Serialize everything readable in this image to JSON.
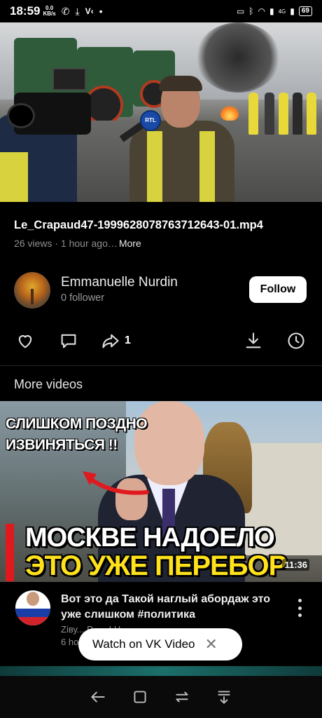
{
  "status_bar": {
    "time": "18:59",
    "speed_value": "0.0",
    "speed_unit": "KB/s",
    "battery": "69",
    "network": "4G"
  },
  "video": {
    "title": "Le_Crapaud47-1999628078763712643-01.mp4",
    "meta": "26 views · 1 hour ago…",
    "more_label": "More",
    "mic_logo": "RTL"
  },
  "channel": {
    "name": "Emmanuelle Nurdin",
    "followers": "0 follower",
    "follow_label": "Follow"
  },
  "actions": {
    "share_count": "1",
    "icons": [
      "heart-icon",
      "comment-icon",
      "share-icon",
      "download-icon",
      "clock-icon"
    ]
  },
  "section": {
    "more_videos": "More videos"
  },
  "related": {
    "caption_top_line1": "СЛИШКОМ ПОЗДНО",
    "caption_top_line2": "ИЗВИНЯТЬСЯ !!",
    "caption_big_line1": "МОСКВЕ НАДОЕЛО",
    "caption_big_line2": "ЭТО УЖЕ ПЕРЕБОР",
    "duration": "11:36",
    "title": "Вот это да Такой наглый абордаж это уже слишком #политика",
    "channel_partial": "Zіву... Р...... І Н... ...",
    "age_partial": "6 ho"
  },
  "toast": {
    "label": "Watch on VK Video"
  },
  "colors": {
    "background": "#000000",
    "follow_bg": "#ffffff",
    "caption_yellow": "#ffe21c",
    "caption_red": "#e0191e"
  }
}
